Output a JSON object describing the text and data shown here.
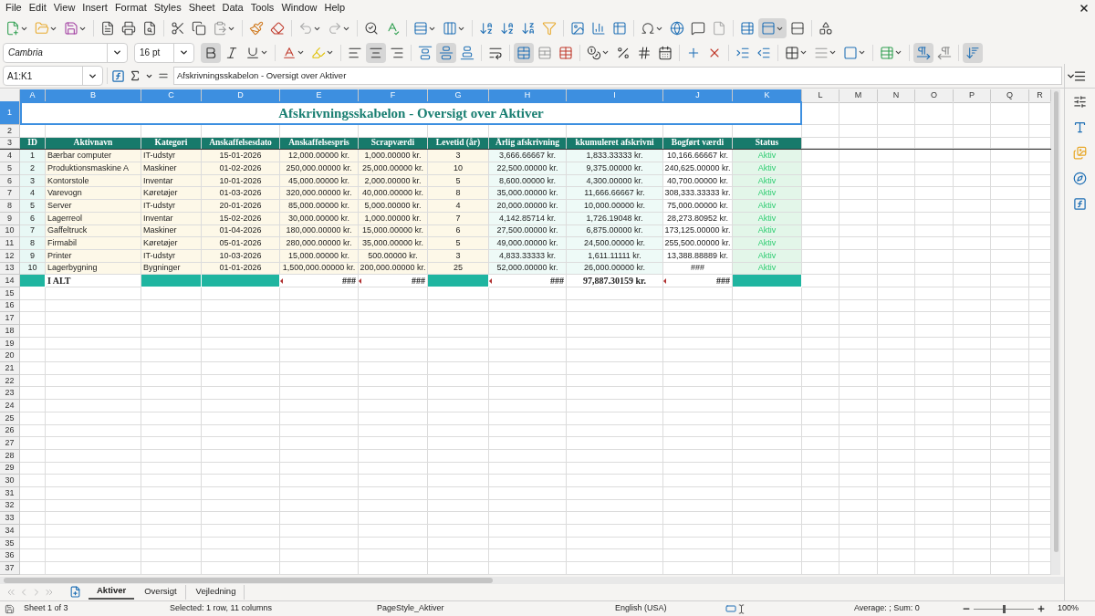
{
  "menu": [
    "File",
    "Edit",
    "View",
    "Insert",
    "Format",
    "Styles",
    "Sheet",
    "Data",
    "Tools",
    "Window",
    "Help"
  ],
  "standard_toolbar": [
    {
      "on": false
    },
    {
      "on": false
    },
    {
      "on": false
    },
    {
      "on": false
    },
    {
      "on": false
    },
    {
      "on": false
    },
    {
      "on": false
    },
    {
      "on": false
    },
    {
      "on": false
    },
    {
      "on": false
    },
    {
      "on": false
    },
    {
      "on": false
    },
    {
      "on": false
    },
    {
      "on": false
    },
    {
      "on": false
    },
    {
      "on": false
    },
    {
      "on": false
    },
    {
      "on": false
    },
    {
      "on": false
    },
    {
      "on": false
    },
    {
      "on": false
    },
    {
      "on": false
    },
    {
      "on": false
    },
    {
      "on": false
    },
    {
      "on": false
    },
    {
      "on": false
    },
    {
      "on": false
    },
    {
      "on": false
    },
    {
      "on": false
    },
    {
      "on": true
    },
    {
      "on": false
    },
    {
      "on": false
    }
  ],
  "format_toolbar": {
    "font": "Cambria",
    "size": "16 pt",
    "buttons": [
      {
        "on": true
      },
      {
        "on": false
      },
      {
        "on": false
      },
      {
        "on": false
      },
      {
        "on": false
      },
      {
        "on": false
      },
      {
        "on": true
      },
      {
        "on": false
      },
      {
        "on": false
      },
      {
        "on": true
      },
      {
        "on": false
      },
      {
        "on": false
      },
      {
        "on": true
      },
      {
        "on": false
      },
      {
        "on": false
      },
      {
        "on": false
      },
      {
        "on": false
      },
      {
        "on": false
      },
      {
        "on": false
      },
      {
        "on": false
      },
      {
        "on": false
      },
      {
        "on": false
      },
      {
        "on": false
      },
      {
        "on": false
      },
      {
        "on": false
      },
      {
        "on": false
      },
      {
        "on": false
      },
      {
        "on": true
      },
      {
        "on": false
      },
      {
        "on": true
      }
    ]
  },
  "formula_bar": {
    "name_box": "A1:K1",
    "value": "Afskrivningsskabelon - Oversigt over Aktiver"
  },
  "columns": [
    {
      "label": "A",
      "selected": true
    },
    {
      "label": "B",
      "selected": true
    },
    {
      "label": "C",
      "selected": true
    },
    {
      "label": "D",
      "selected": true
    },
    {
      "label": "E",
      "selected": true
    },
    {
      "label": "F",
      "selected": true
    },
    {
      "label": "G",
      "selected": true
    },
    {
      "label": "H",
      "selected": true
    },
    {
      "label": "I",
      "selected": true
    },
    {
      "label": "J",
      "selected": true
    },
    {
      "label": "K",
      "selected": true
    },
    {
      "label": "L",
      "selected": false
    },
    {
      "label": "M",
      "selected": false
    },
    {
      "label": "N",
      "selected": false
    },
    {
      "label": "O",
      "selected": false
    },
    {
      "label": "P",
      "selected": false
    },
    {
      "label": "Q",
      "selected": false
    },
    {
      "label": "R",
      "selected": false
    }
  ],
  "rows": [
    {
      "label": "1",
      "selected": true
    },
    {
      "label": "2",
      "selected": false
    },
    {
      "label": "3",
      "selected": false
    },
    {
      "label": "4",
      "selected": false
    },
    {
      "label": "5",
      "selected": false
    },
    {
      "label": "6",
      "selected": false
    },
    {
      "label": "7",
      "selected": false
    },
    {
      "label": "8",
      "selected": false
    },
    {
      "label": "9",
      "selected": false
    },
    {
      "label": "10",
      "selected": false
    },
    {
      "label": "11",
      "selected": false
    },
    {
      "label": "12",
      "selected": false
    },
    {
      "label": "13",
      "selected": false
    },
    {
      "label": "14",
      "selected": false
    },
    {
      "label": "15",
      "selected": false
    },
    {
      "label": "16",
      "selected": false
    },
    {
      "label": "17",
      "selected": false
    },
    {
      "label": "18",
      "selected": false
    },
    {
      "label": "19",
      "selected": false
    },
    {
      "label": "20",
      "selected": false
    },
    {
      "label": "21",
      "selected": false
    },
    {
      "label": "22",
      "selected": false
    },
    {
      "label": "23",
      "selected": false
    },
    {
      "label": "24",
      "selected": false
    },
    {
      "label": "25",
      "selected": false
    },
    {
      "label": "26",
      "selected": false
    },
    {
      "label": "27",
      "selected": false
    },
    {
      "label": "28",
      "selected": false
    },
    {
      "label": "29",
      "selected": false
    },
    {
      "label": "30",
      "selected": false
    },
    {
      "label": "31",
      "selected": false
    },
    {
      "label": "32",
      "selected": false
    },
    {
      "label": "33",
      "selected": false
    },
    {
      "label": "34",
      "selected": false
    },
    {
      "label": "35",
      "selected": false
    },
    {
      "label": "36",
      "selected": false
    },
    {
      "label": "37",
      "selected": false
    }
  ],
  "sheet": {
    "title": "Afskrivningsskabelon - Oversigt over Aktiver",
    "header": [
      "ID",
      "Aktivnavn",
      "Kategori",
      "Anskaffelsesdato",
      "Anskaffelsespris",
      "Scrapværdi",
      "Levetid (år)",
      "Årlig afskrivning",
      "kkumuleret afskrivni",
      "Bogført værdi",
      "Status"
    ],
    "data": [
      [
        "1",
        "Bærbar computer",
        "IT-udstyr",
        "15-01-2026",
        "12,000.00000 kr.",
        "1,000.00000 kr.",
        "3",
        "3,666.66667 kr.",
        "1,833.33333 kr.",
        "10,166.66667 kr.",
        "Aktiv"
      ],
      [
        "2",
        "Produktionsmaskine A",
        "Maskiner",
        "01-02-2026",
        "250,000.00000 kr.",
        "25,000.00000 kr.",
        "10",
        "22,500.00000 kr.",
        "9,375.00000 kr.",
        "240,625.00000 kr.",
        "Aktiv"
      ],
      [
        "3",
        "Kontorstole",
        "Inventar",
        "10-01-2026",
        "45,000.00000 kr.",
        "2,000.00000 kr.",
        "5",
        "8,600.00000 kr.",
        "4,300.00000 kr.",
        "40,700.00000 kr.",
        "Aktiv"
      ],
      [
        "4",
        "Varevogn",
        "Køretøjer",
        "01-03-2026",
        "320,000.00000 kr.",
        "40,000.00000 kr.",
        "8",
        "35,000.00000 kr.",
        "11,666.66667 kr.",
        "308,333.33333 kr.",
        "Aktiv"
      ],
      [
        "5",
        "Server",
        "IT-udstyr",
        "20-01-2026",
        "85,000.00000 kr.",
        "5,000.00000 kr.",
        "4",
        "20,000.00000 kr.",
        "10,000.00000 kr.",
        "75,000.00000 kr.",
        "Aktiv"
      ],
      [
        "6",
        "Lagerreol",
        "Inventar",
        "15-02-2026",
        "30,000.00000 kr.",
        "1,000.00000 kr.",
        "7",
        "4,142.85714 kr.",
        "1,726.19048 kr.",
        "28,273.80952 kr.",
        "Aktiv"
      ],
      [
        "7",
        "Gaffeltruck",
        "Maskiner",
        "01-04-2026",
        "180,000.00000 kr.",
        "15,000.00000 kr.",
        "6",
        "27,500.00000 kr.",
        "6,875.00000 kr.",
        "173,125.00000 kr.",
        "Aktiv"
      ],
      [
        "8",
        "Firmabil",
        "Køretøjer",
        "05-01-2026",
        "280,000.00000 kr.",
        "35,000.00000 kr.",
        "5",
        "49,000.00000 kr.",
        "24,500.00000 kr.",
        "255,500.00000 kr.",
        "Aktiv"
      ],
      [
        "9",
        "Printer",
        "IT-udstyr",
        "10-03-2026",
        "15,000.00000 kr.",
        "500.00000 kr.",
        "3",
        "4,833.33333 kr.",
        "1,611.11111 kr.",
        "13,388.88889 kr.",
        "Aktiv"
      ],
      [
        "10",
        "Lagerbygning",
        "Bygninger",
        "01-01-2026",
        "1,500,000.00000 kr.",
        "200,000.00000 kr.",
        "25",
        "52,000.00000 kr.",
        "26,000.00000 kr.",
        "###",
        "Aktiv"
      ]
    ],
    "total": [
      {
        "kind": "fill"
      },
      {
        "kind": "label",
        "text": "I ALT"
      },
      {
        "kind": "fill"
      },
      {
        "kind": "fill"
      },
      {
        "kind": "overflow",
        "text": "###"
      },
      {
        "kind": "overflow",
        "text": "###"
      },
      {
        "kind": "fill"
      },
      {
        "kind": "overflow",
        "text": "###"
      },
      {
        "kind": "value",
        "text": "97,887.30159 kr."
      },
      {
        "kind": "overflow",
        "text": "###"
      },
      {
        "kind": "fill"
      }
    ]
  },
  "sheet_tabs": [
    {
      "label": "Aktiver",
      "selected": true
    },
    {
      "label": "Oversigt",
      "selected": false
    },
    {
      "label": "Vejledning",
      "selected": false
    }
  ],
  "status_bar": {
    "sheet": "Sheet 1 of 3",
    "selection": "Selected: 1 row, 11 columns",
    "page_style": "PageStyle_Aktiver",
    "language": "English (USA)",
    "summary": "Average: ; Sum: 0",
    "zoom": {
      "level": 0.5,
      "reading": "100%"
    }
  }
}
